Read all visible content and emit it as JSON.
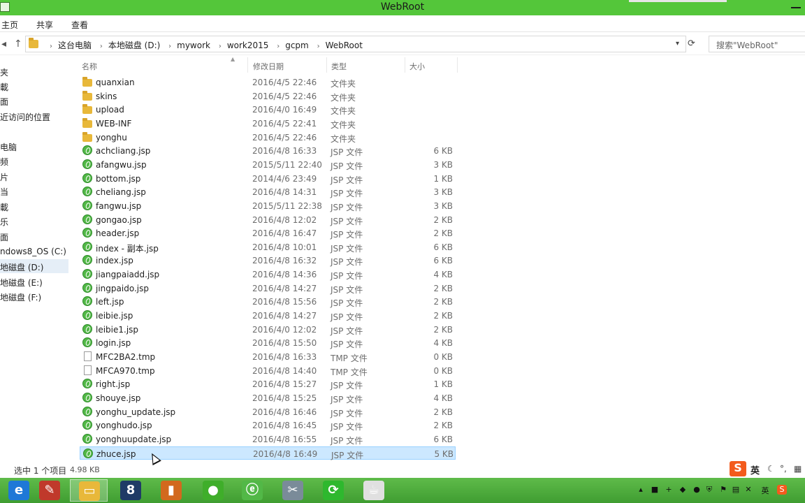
{
  "window": {
    "title": "WebRoot"
  },
  "ribbon": {
    "tabs": [
      "主页",
      "共享",
      "查看"
    ]
  },
  "address": {
    "crumbs": [
      "这台电脑",
      "本地磁盘 (D:)",
      "mywork",
      "work2015",
      "gcpm",
      "WebRoot"
    ],
    "search_placeholder": "搜索\"WebRoot\""
  },
  "nav": {
    "items": [
      {
        "label": "夹",
        "selected": false
      },
      {
        "label": "載",
        "selected": false
      },
      {
        "label": "面",
        "selected": false
      },
      {
        "label": "近访问的位置",
        "selected": false
      },
      {
        "label": "电脑",
        "selected": false
      },
      {
        "label": "频",
        "selected": false
      },
      {
        "label": "片",
        "selected": false
      },
      {
        "label": "当",
        "selected": false
      },
      {
        "label": "載",
        "selected": false
      },
      {
        "label": "乐",
        "selected": false
      },
      {
        "label": "面",
        "selected": false
      },
      {
        "label": "ndows8_OS (C:)",
        "selected": false
      },
      {
        "label": "地磁盘 (D:)",
        "selected": true
      },
      {
        "label": "地磁盘 (E:)",
        "selected": false
      },
      {
        "label": "地磁盘 (F:)",
        "selected": false
      }
    ]
  },
  "columns": {
    "name": "名称",
    "date": "修改日期",
    "type": "类型",
    "size": "大小"
  },
  "files": [
    {
      "name": "quanxian",
      "date": "2016/4/5 22:46",
      "type": "文件夹",
      "size": "",
      "icon": "folder"
    },
    {
      "name": "skins",
      "date": "2016/4/5 22:46",
      "type": "文件夹",
      "size": "",
      "icon": "folder"
    },
    {
      "name": "upload",
      "date": "2016/4/0 16:49",
      "type": "文件夹",
      "size": "",
      "icon": "folder"
    },
    {
      "name": "WEB-INF",
      "date": "2016/4/5 22:41",
      "type": "文件夹",
      "size": "",
      "icon": "folder"
    },
    {
      "name": "yonghu",
      "date": "2016/4/5 22:46",
      "type": "文件夹",
      "size": "",
      "icon": "folder"
    },
    {
      "name": "achcliang.jsp",
      "date": "2016/4/8 16:33",
      "type": "JSP 文件",
      "size": "6 KB",
      "icon": "jsp"
    },
    {
      "name": "afangwu.jsp",
      "date": "2015/5/11 22:40",
      "type": "JSP 文件",
      "size": "3 KB",
      "icon": "jsp"
    },
    {
      "name": "bottom.jsp",
      "date": "2014/4/6 23:49",
      "type": "JSP 文件",
      "size": "1 KB",
      "icon": "jsp"
    },
    {
      "name": "cheliang.jsp",
      "date": "2016/4/8 14:31",
      "type": "JSP 文件",
      "size": "3 KB",
      "icon": "jsp"
    },
    {
      "name": "fangwu.jsp",
      "date": "2015/5/11 22:38",
      "type": "JSP 文件",
      "size": "3 KB",
      "icon": "jsp"
    },
    {
      "name": "gongao.jsp",
      "date": "2016/4/8 12:02",
      "type": "JSP 文件",
      "size": "2 KB",
      "icon": "jsp"
    },
    {
      "name": "header.jsp",
      "date": "2016/4/8 16:47",
      "type": "JSP 文件",
      "size": "2 KB",
      "icon": "jsp"
    },
    {
      "name": "index - 副本.jsp",
      "date": "2016/4/8 10:01",
      "type": "JSP 文件",
      "size": "6 KB",
      "icon": "jsp"
    },
    {
      "name": "index.jsp",
      "date": "2016/4/8 16:32",
      "type": "JSP 文件",
      "size": "6 KB",
      "icon": "jsp"
    },
    {
      "name": "jiangpaiadd.jsp",
      "date": "2016/4/8 14:36",
      "type": "JSP 文件",
      "size": "4 KB",
      "icon": "jsp"
    },
    {
      "name": "jingpaido.jsp",
      "date": "2016/4/8 14:27",
      "type": "JSP 文件",
      "size": "2 KB",
      "icon": "jsp"
    },
    {
      "name": "left.jsp",
      "date": "2016/4/8 15:56",
      "type": "JSP 文件",
      "size": "2 KB",
      "icon": "jsp"
    },
    {
      "name": "leibie.jsp",
      "date": "2016/4/8 14:27",
      "type": "JSP 文件",
      "size": "2 KB",
      "icon": "jsp"
    },
    {
      "name": "leibie1.jsp",
      "date": "2016/4/0 12:02",
      "type": "JSP 文件",
      "size": "2 KB",
      "icon": "jsp"
    },
    {
      "name": "login.jsp",
      "date": "2016/4/8 15:50",
      "type": "JSP 文件",
      "size": "4 KB",
      "icon": "jsp"
    },
    {
      "name": "MFC2BA2.tmp",
      "date": "2016/4/8 16:33",
      "type": "TMP 文件",
      "size": "0 KB",
      "icon": "tmp"
    },
    {
      "name": "MFCA970.tmp",
      "date": "2016/4/8 14:40",
      "type": "TMP 文件",
      "size": "0 KB",
      "icon": "tmp"
    },
    {
      "name": "right.jsp",
      "date": "2016/4/8 15:27",
      "type": "JSP 文件",
      "size": "1 KB",
      "icon": "jsp"
    },
    {
      "name": "shouye.jsp",
      "date": "2016/4/8 15:25",
      "type": "JSP 文件",
      "size": "4 KB",
      "icon": "jsp"
    },
    {
      "name": "yonghu_update.jsp",
      "date": "2016/4/8 16:46",
      "type": "JSP 文件",
      "size": "2 KB",
      "icon": "jsp"
    },
    {
      "name": "yonghudo.jsp",
      "date": "2016/4/8 16:45",
      "type": "JSP 文件",
      "size": "2 KB",
      "icon": "jsp"
    },
    {
      "name": "yonghuupdate.jsp",
      "date": "2016/4/8 16:55",
      "type": "JSP 文件",
      "size": "6 KB",
      "icon": "jsp"
    },
    {
      "name": "zhuce.jsp",
      "date": "2016/4/8 16:49",
      "type": "JSP 文件",
      "size": "5 KB",
      "icon": "jsp",
      "selected": true
    }
  ],
  "status": {
    "selected_text": "选中 1 个项目",
    "selected_size": "4.98 KB"
  },
  "ime": {
    "logo": "S",
    "mode": "英"
  },
  "taskbar": {
    "items": [
      {
        "icon": "ie-icon",
        "glyph": "e",
        "color": "#1e78d7"
      },
      {
        "icon": "notes-icon",
        "glyph": "✎",
        "color": "#c0392b"
      },
      {
        "icon": "explorer-icon",
        "glyph": "▭",
        "color": "#e8b83a",
        "active": true
      },
      {
        "icon": "app-8-icon",
        "glyph": "8",
        "color": "#1f3b66"
      },
      {
        "icon": "book-icon",
        "glyph": "▮",
        "color": "#d2691e"
      },
      {
        "icon": "paw-icon",
        "glyph": "●",
        "color": "#3fae2a"
      },
      {
        "icon": "jsp-icon",
        "glyph": "ⓔ",
        "color": "#52b847"
      },
      {
        "icon": "tool-icon",
        "glyph": "✂",
        "color": "#7a8b99"
      },
      {
        "icon": "refresh-app-icon",
        "glyph": "⟳",
        "color": "#2eb82e"
      },
      {
        "icon": "java-icon",
        "glyph": "☕",
        "color": "#e0e0e0"
      }
    ]
  },
  "tray": {
    "lang": "英"
  }
}
